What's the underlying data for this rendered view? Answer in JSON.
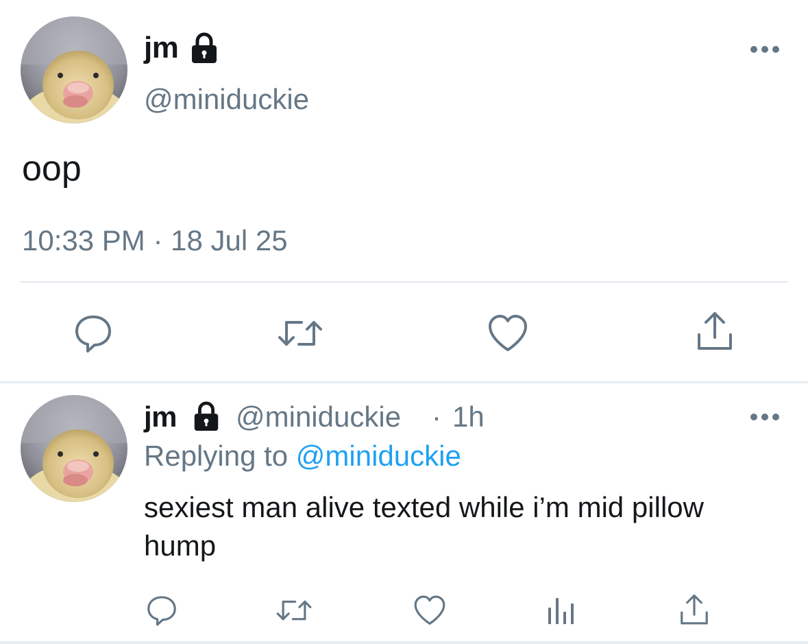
{
  "main_tweet": {
    "author": {
      "display_name": "jm",
      "handle": "@miniduckie",
      "protected_icon": "lock-icon",
      "avatar": "duckling-avatar"
    },
    "more_icon": "more-dots-icon",
    "text": "oop",
    "timestamp": "10:33 PM · 18 Jul 25",
    "actions": [
      {
        "name": "reply",
        "icon": "reply-bubble-icon"
      },
      {
        "name": "retweet",
        "icon": "retweet-icon"
      },
      {
        "name": "like",
        "icon": "heart-icon"
      },
      {
        "name": "share",
        "icon": "share-icon"
      }
    ]
  },
  "reply_tweet": {
    "author": {
      "display_name": "jm",
      "handle": "@miniduckie",
      "protected_icon": "lock-icon",
      "avatar": "duckling-avatar"
    },
    "separator": "·",
    "relative_time": "1h",
    "more_icon": "more-dots-icon",
    "replying_prefix": "Replying to",
    "replying_to": "@miniduckie",
    "text": "sexiest man alive texted while i’m mid pillow hump",
    "actions": [
      {
        "name": "reply",
        "icon": "reply-bubble-icon"
      },
      {
        "name": "retweet",
        "icon": "retweet-icon"
      },
      {
        "name": "like",
        "icon": "heart-icon"
      },
      {
        "name": "analytics",
        "icon": "analytics-icon"
      },
      {
        "name": "share",
        "icon": "share-icon"
      }
    ]
  },
  "colors": {
    "text_primary": "#14171a",
    "text_secondary": "#657786",
    "link": "#1da1f2",
    "icon": "#657786",
    "divider": "#e6ecf0"
  }
}
